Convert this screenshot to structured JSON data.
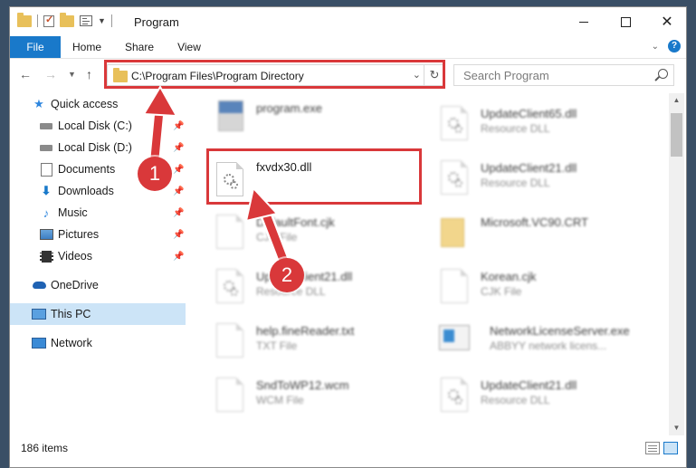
{
  "window": {
    "title": "Program"
  },
  "ribbon": {
    "tabs": [
      "File",
      "Home",
      "Share",
      "View"
    ]
  },
  "address": {
    "path": "C:\\Program Files\\Program Directory"
  },
  "search": {
    "placeholder": "Search Program"
  },
  "sidebar": {
    "items": [
      {
        "label": "Quick access",
        "icon": "star-icon",
        "pinned": false
      },
      {
        "label": "Local Disk (C:)",
        "icon": "drive-icon",
        "pinned": true
      },
      {
        "label": "Local Disk (D:)",
        "icon": "drive-icon",
        "pinned": true
      },
      {
        "label": "Documents",
        "icon": "documents-icon",
        "pinned": true
      },
      {
        "label": "Downloads",
        "icon": "download-icon",
        "pinned": true
      },
      {
        "label": "Music",
        "icon": "music-icon",
        "pinned": true
      },
      {
        "label": "Pictures",
        "icon": "pictures-icon",
        "pinned": true
      },
      {
        "label": "Videos",
        "icon": "videos-icon",
        "pinned": true
      },
      {
        "label": "OneDrive",
        "icon": "cloud-icon",
        "pinned": false
      },
      {
        "label": "This PC",
        "icon": "computer-icon",
        "pinned": false,
        "selected": true
      },
      {
        "label": "Network",
        "icon": "network-icon",
        "pinned": false
      }
    ]
  },
  "files": {
    "left": [
      {
        "name": "program.exe",
        "desc": "",
        "icon": "exe-icon"
      },
      {
        "name": "fxvdx30.dll",
        "desc": "",
        "icon": "dll-icon",
        "highlighted": true
      },
      {
        "name": "DefaultFont.cjk",
        "desc": "CJK File",
        "icon": "file-icon"
      },
      {
        "name": "UpdateClient21.dll",
        "desc": "Resource DLL",
        "icon": "dll-icon"
      },
      {
        "name": "help.fineReader.txt",
        "desc": "TXT File",
        "icon": "file-icon"
      },
      {
        "name": "SndToWP12.wcm",
        "desc": "WCM File",
        "icon": "file-icon"
      }
    ],
    "right": [
      {
        "name": "UpdateClient65.dll",
        "desc": "Resource DLL",
        "icon": "dll-icon"
      },
      {
        "name": "UpdateClient21.dll",
        "desc": "Resource DLL",
        "icon": "dll-icon"
      },
      {
        "name": "Microsoft.VC90.CRT",
        "desc": "",
        "icon": "folder-icon"
      },
      {
        "name": "Korean.cjk",
        "desc": "CJK File",
        "icon": "file-icon"
      },
      {
        "name": "NetworkLicenseServer.exe",
        "desc": "ABBYY network licens...",
        "icon": "network-app-icon"
      },
      {
        "name": "UpdateClient21.dll",
        "desc": "Resource DLL",
        "icon": "dll-icon"
      }
    ]
  },
  "status": {
    "count": "186 items"
  },
  "annotations": {
    "step1": "1",
    "step2": "2"
  },
  "colors": {
    "accent": "#1979ca",
    "highlight": "#d9383a",
    "selection": "#cce4f7"
  }
}
